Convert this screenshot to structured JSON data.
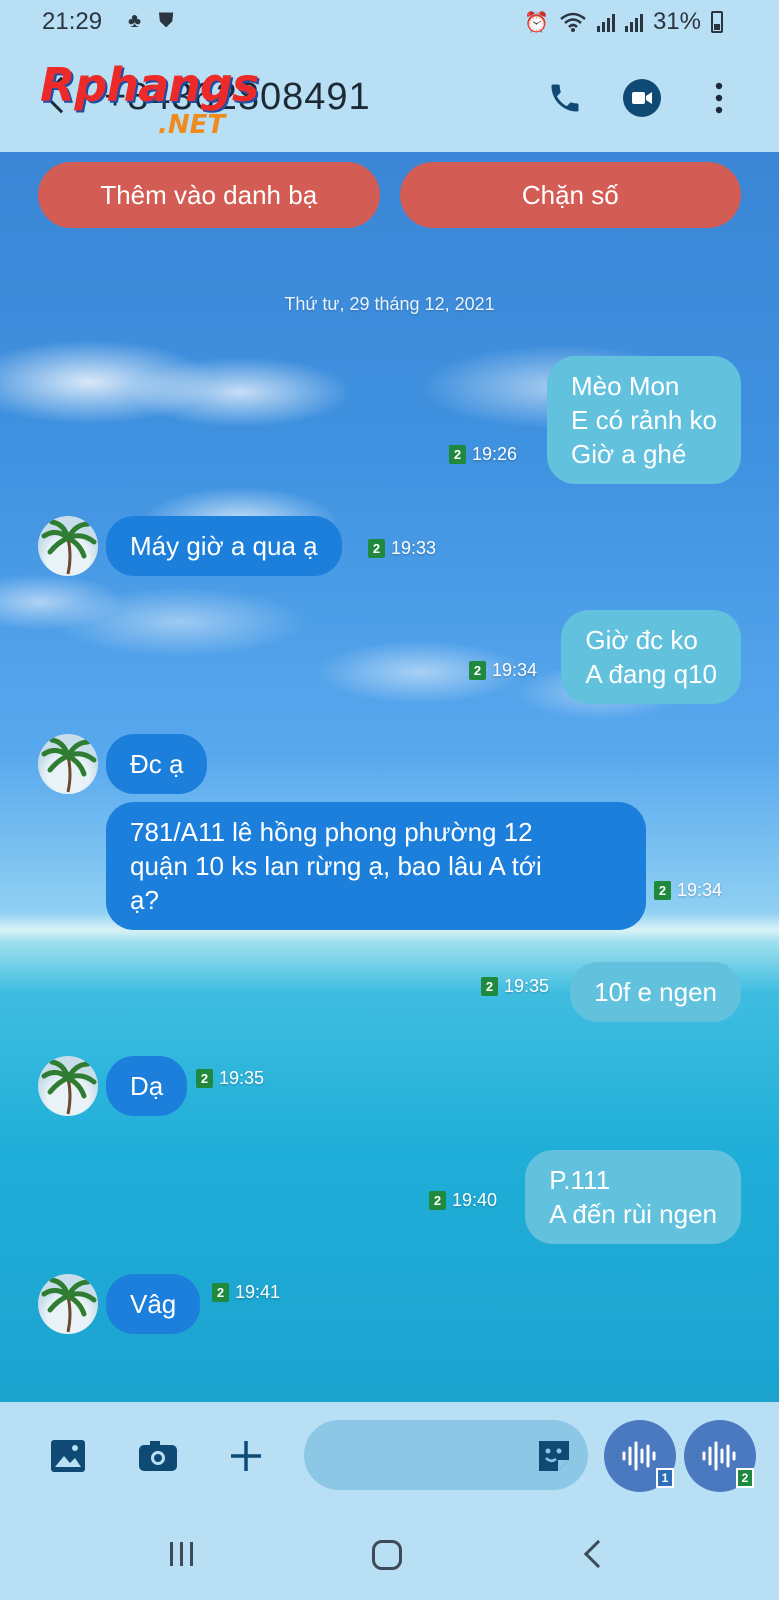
{
  "status_bar": {
    "time": "21:29",
    "battery": "31%"
  },
  "header": {
    "contact_number": "+84362808491"
  },
  "watermark": {
    "main": "Rphangs",
    "sub": ".NET"
  },
  "actions": {
    "add_contact": "Thêm vào danh bạ",
    "block": "Chặn số"
  },
  "date_separator": "Thứ tư, 29 tháng 12, 2021",
  "messages": [
    {
      "dir": "out",
      "text": "Mèo Mon\nE có rảnh ko\nGiờ a ghé",
      "sim": "2",
      "time": "19:26"
    },
    {
      "dir": "in",
      "text": "Máy giờ a qua ạ",
      "sim": "2",
      "time": "19:33"
    },
    {
      "dir": "out",
      "text": "Giờ đc ko\nA đang q10",
      "sim": "2",
      "time": "19:34"
    },
    {
      "dir": "in",
      "text": "Đc ạ",
      "sim": "",
      "time": ""
    },
    {
      "dir": "in",
      "text": "781/A11 lê hồng phong phường 12\nquận 10 ks lan rừng ạ, bao lâu A tới\nạ?",
      "sim": "2",
      "time": "19:34"
    },
    {
      "dir": "out",
      "text": "10f e ngen",
      "sim": "2",
      "time": "19:35"
    },
    {
      "dir": "in",
      "text": "Dạ",
      "sim": "2",
      "time": "19:35"
    },
    {
      "dir": "out",
      "text": "P.111\nA đến rùi ngen",
      "sim": "2",
      "time": "19:40"
    },
    {
      "dir": "in",
      "text": "Vâg",
      "sim": "2",
      "time": "19:41"
    }
  ],
  "composer": {
    "voice_sim1": "1",
    "voice_sim2": "2"
  }
}
